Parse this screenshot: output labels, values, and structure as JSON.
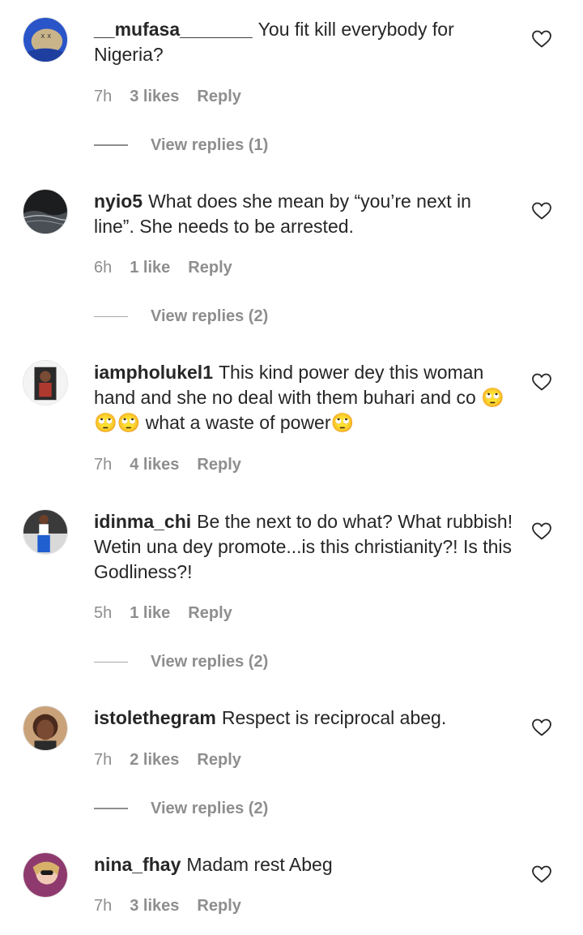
{
  "comments": [
    {
      "username": "__mufasa_______",
      "text": "You fit kill everybody for Nigeria?",
      "time": "7h",
      "likes": "3 likes",
      "reply": "Reply",
      "view_replies": "View replies (1)"
    },
    {
      "username": "nyio5",
      "text": "What does she mean by “you’re next in line”. She needs to be arrested.",
      "time": "6h",
      "likes": "1 like",
      "reply": "Reply",
      "view_replies": "View replies (2)"
    },
    {
      "username": "iampholukel1",
      "text": "This kind power dey this woman hand and she no deal with them buhari and co 🙄🙄🙄 what a waste of power🙄",
      "time": "7h",
      "likes": "4 likes",
      "reply": "Reply"
    },
    {
      "username": "idinma_chi",
      "text": "Be the next to do what? What rubbish! Wetin una dey promote...is this christianity?! Is this Godliness?!",
      "time": "5h",
      "likes": "1 like",
      "reply": "Reply",
      "view_replies": "View replies (2)"
    },
    {
      "username": "istolethegram",
      "text": "Respect is reciprocal abeg.",
      "time": "7h",
      "likes": "2 likes",
      "reply": "Reply",
      "view_replies": "View replies (2)"
    },
    {
      "username": "nina_fhay",
      "text": "Madam rest Abeg",
      "time": "7h",
      "likes": "3 likes",
      "reply": "Reply"
    }
  ],
  "icons": {
    "like": "heart-outline-icon"
  },
  "colors": {
    "text": "#262626",
    "secondary": "#8e8e8e"
  }
}
